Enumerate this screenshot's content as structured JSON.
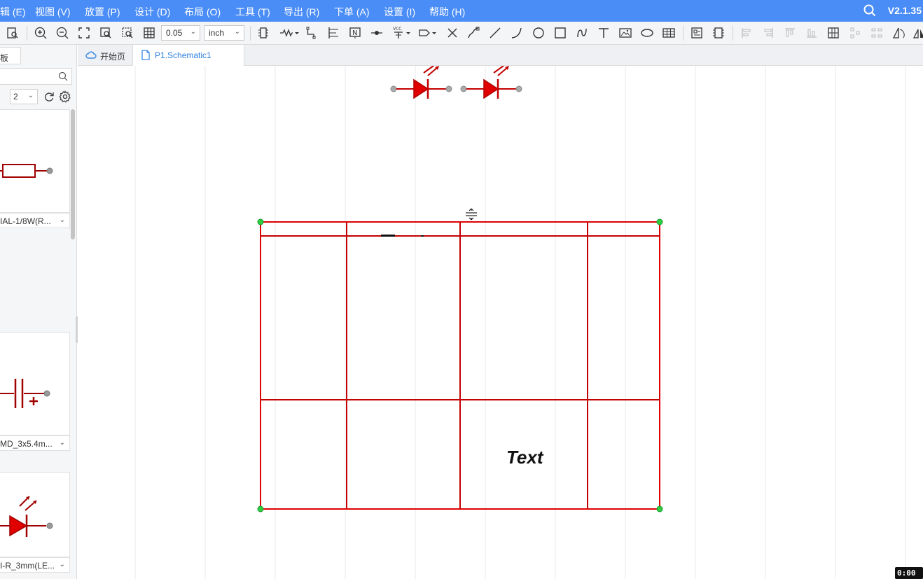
{
  "app": {
    "version": "V2.1.35"
  },
  "menu": [
    {
      "label": "辑 (E)"
    },
    {
      "label": "视图 (V)"
    },
    {
      "label": "放置 (P)"
    },
    {
      "label": "设计 (D)"
    },
    {
      "label": "布局 (O)"
    },
    {
      "label": "工具 (T)"
    },
    {
      "label": "导出 (R)"
    },
    {
      "label": "下单 (A)"
    },
    {
      "label": "设置 (I)"
    },
    {
      "label": "帮助 (H)"
    }
  ],
  "toolbar": {
    "grid_size": "0.05",
    "unit": "inch",
    "icons": [
      "print-preview-icon",
      "zoom-in-icon",
      "zoom-out-icon",
      "fit-view-icon",
      "zoom-area-icon",
      "zoom-selection-icon",
      "grid-icon",
      "component-icon",
      "wire-icon",
      "bus-icon",
      "bus-entry-icon",
      "net-label-icon",
      "net-flag-icon",
      "vcc-icon",
      "net-port-icon",
      "no-connect-icon",
      "freehand-icon",
      "line-icon",
      "arc-icon",
      "circle-icon",
      "rectangle-icon",
      "bezier-icon",
      "text-icon",
      "image-icon",
      "ellipse-icon",
      "table-icon",
      "netlist-icon",
      "bom-icon",
      "align-left-icon",
      "align-right-icon",
      "align-top-icon",
      "align-bottom-icon",
      "distribute-h-icon",
      "distribute-v-icon",
      "distribute-grid-icon",
      "rotate-icon",
      "flip-icon"
    ]
  },
  "left_panel": {
    "tab_label": "板",
    "page_number": "2",
    "cards": [
      {
        "label": "IAL-1/8W(R...",
        "symbol": "resistor"
      },
      {
        "label": "MD_3x5.4m...",
        "symbol": "capacitor"
      },
      {
        "label": "I-R_3mm(LE...",
        "symbol": "led"
      }
    ]
  },
  "tabs": [
    {
      "label": "开始页",
      "icon": "cloud-icon"
    },
    {
      "label": "P1.Schematic1",
      "icon": "file-icon",
      "active": true
    }
  ],
  "canvas": {
    "table_text": "Text",
    "table_rows": 3,
    "table_cols": 4,
    "wire_color": "#c40000",
    "handle_color": "#2ecc40"
  },
  "timer": "0:00"
}
